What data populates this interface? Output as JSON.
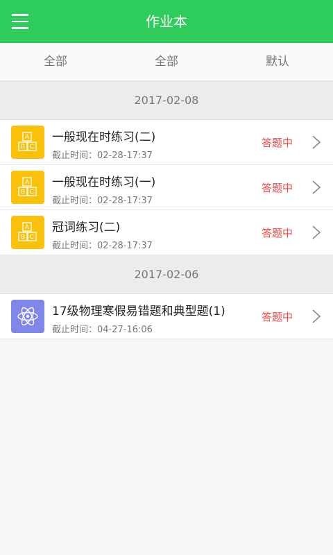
{
  "header": {
    "title": "作业本",
    "menu_icon": "hamburger-menu-icon"
  },
  "filters": [
    "全部",
    "全部",
    "默认"
  ],
  "groups": [
    {
      "date": "2017-02-08",
      "items": [
        {
          "title": "一般现在时练习(二)",
          "deadline": "截止时间：02-28-17:37",
          "status": "答题中",
          "icon": "abc-blocks-icon"
        },
        {
          "title": "一般现在时练习(一)",
          "deadline": "截止时间：02-28-17:37",
          "status": "答题中",
          "icon": "abc-blocks-icon"
        },
        {
          "title": "冠词练习(二)",
          "deadline": "截止时间：02-28-17:37",
          "status": "答题中",
          "icon": "abc-blocks-icon"
        }
      ]
    },
    {
      "date": "2017-02-06",
      "items": [
        {
          "title": "17级物理寒假易错题和典型题(1)",
          "deadline": "截止时间：04-27-16:06",
          "status": "答题中",
          "icon": "atom-icon"
        }
      ]
    }
  ],
  "colors": {
    "header_bg": "#2ecc5a",
    "status": "#f24848",
    "abc_icon_bg": "#f9c10a",
    "atom_icon_bg": "#7f87e9"
  }
}
